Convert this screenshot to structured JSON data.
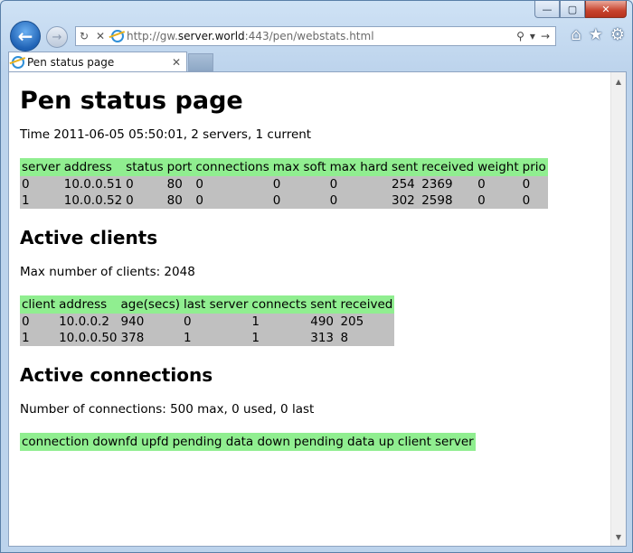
{
  "browser": {
    "address_url_prefix": "http://gw.",
    "address_url_domain": "server.world",
    "address_url_rest": ":443/pen/webstats.html",
    "tab_title": "Pen status page",
    "caption": {
      "minimize": "—",
      "maximize": "▢",
      "close": "✕"
    }
  },
  "page": {
    "title": "Pen status page",
    "summary": "Time 2011-06-05 05:50:01, 2 servers, 1 current",
    "servers": {
      "headers": [
        "server",
        "address",
        "status",
        "port",
        "connections",
        "max soft",
        "max hard",
        "sent",
        "received",
        "weight",
        "prio"
      ],
      "rows": [
        [
          "0",
          "10.0.0.51",
          "0",
          "80",
          "0",
          "0",
          "0",
          "254",
          "2369",
          "0",
          "0"
        ],
        [
          "1",
          "10.0.0.52",
          "0",
          "80",
          "0",
          "0",
          "0",
          "302",
          "2598",
          "0",
          "0"
        ]
      ]
    },
    "clients_heading": "Active clients",
    "clients_summary": "Max number of clients: 2048",
    "clients": {
      "headers": [
        "client",
        "address",
        "age(secs)",
        "last server",
        "connects",
        "sent",
        "received"
      ],
      "rows": [
        [
          "0",
          "10.0.0.2",
          "940",
          "0",
          "1",
          "490",
          "205"
        ],
        [
          "1",
          "10.0.0.50",
          "378",
          "1",
          "1",
          "313",
          "8"
        ]
      ]
    },
    "connections_heading": "Active connections",
    "connections_summary": "Number of connections: 500 max, 0 used, 0 last",
    "connections": {
      "headers": [
        "connection",
        "downfd",
        "upfd",
        "pending data down",
        "pending data up",
        "client",
        "server"
      ]
    }
  }
}
